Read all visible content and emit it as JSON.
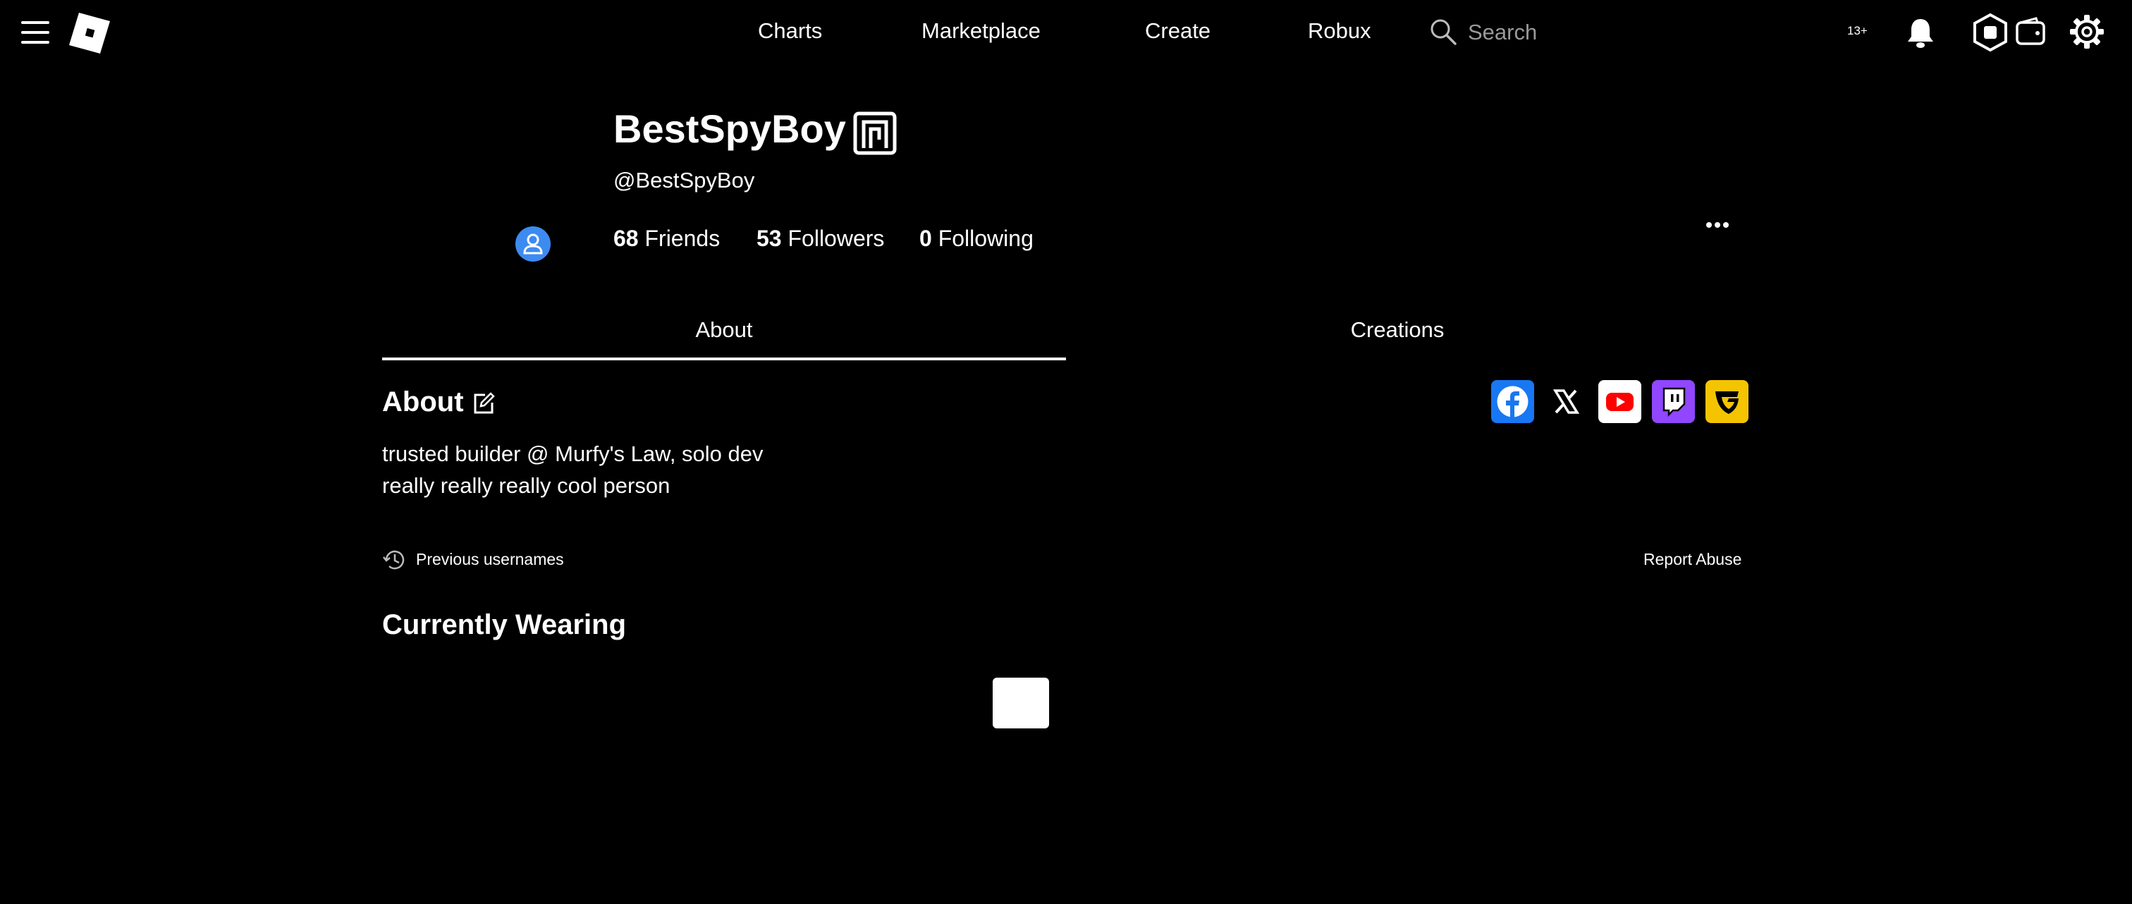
{
  "nav": {
    "links": [
      "Charts",
      "Marketplace",
      "Create",
      "Robux"
    ],
    "search_placeholder": "Search",
    "age_badge": "13+"
  },
  "profile": {
    "display_name": "BestSpyBoy",
    "username": "@BestSpyBoy",
    "stats": [
      {
        "count": "68",
        "label": "Friends"
      },
      {
        "count": "53",
        "label": "Followers"
      },
      {
        "count": "0",
        "label": "Following"
      }
    ]
  },
  "tabs": [
    "About",
    "Creations"
  ],
  "about": {
    "title": "About",
    "bio_lines": [
      "trusted builder @ Murfy's Law, solo dev",
      "really really really cool person"
    ],
    "previous_usernames": "Previous usernames",
    "report_abuse": "Report Abuse"
  },
  "social_links": [
    {
      "icon": "facebook-icon",
      "color": "#1877f2"
    },
    {
      "icon": "x-icon",
      "color": "#000000"
    },
    {
      "icon": "youtube-icon",
      "color": "#ffffff"
    },
    {
      "icon": "twitch-icon",
      "color": "#9146ff"
    },
    {
      "icon": "guilded-icon",
      "color": "#f5c400"
    }
  ],
  "currently_wearing": {
    "title": "Currently Wearing"
  },
  "colors": {
    "background": "#000000",
    "accent_avatar": "#3d8bf0"
  }
}
